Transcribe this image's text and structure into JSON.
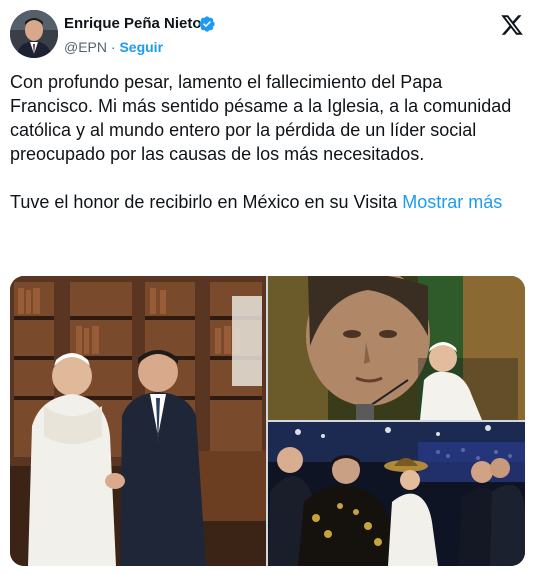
{
  "author": {
    "name": "Enrique Peña Nieto",
    "handle": "@EPN",
    "separator": "·",
    "follow_label": "Seguir"
  },
  "icons": {
    "avatar": "profile-photo",
    "verified": "verified-badge-icon",
    "platform": "x-logo-icon"
  },
  "tweet": {
    "paragraph1": "Con profundo pesar, lamento el fallecimiento del Papa Francisco. Mi más sentido pésame a la Iglesia, a la comunidad católica y al mundo entero por la pérdida de un líder social preocupado por las causas de los más necesitados.",
    "paragraph2": "Tuve el honor de recibirlo en México en su Visita ",
    "show_more": "Mostrar más"
  },
  "media": {
    "photos": [
      "photo-pope-handshake-library",
      "photo-pope-virgin-of-guadalupe",
      "photo-pope-mariachi-ceremony"
    ]
  },
  "colors": {
    "accent": "#1d9bf0",
    "text": "#0f1419",
    "secondary": "#536471"
  }
}
